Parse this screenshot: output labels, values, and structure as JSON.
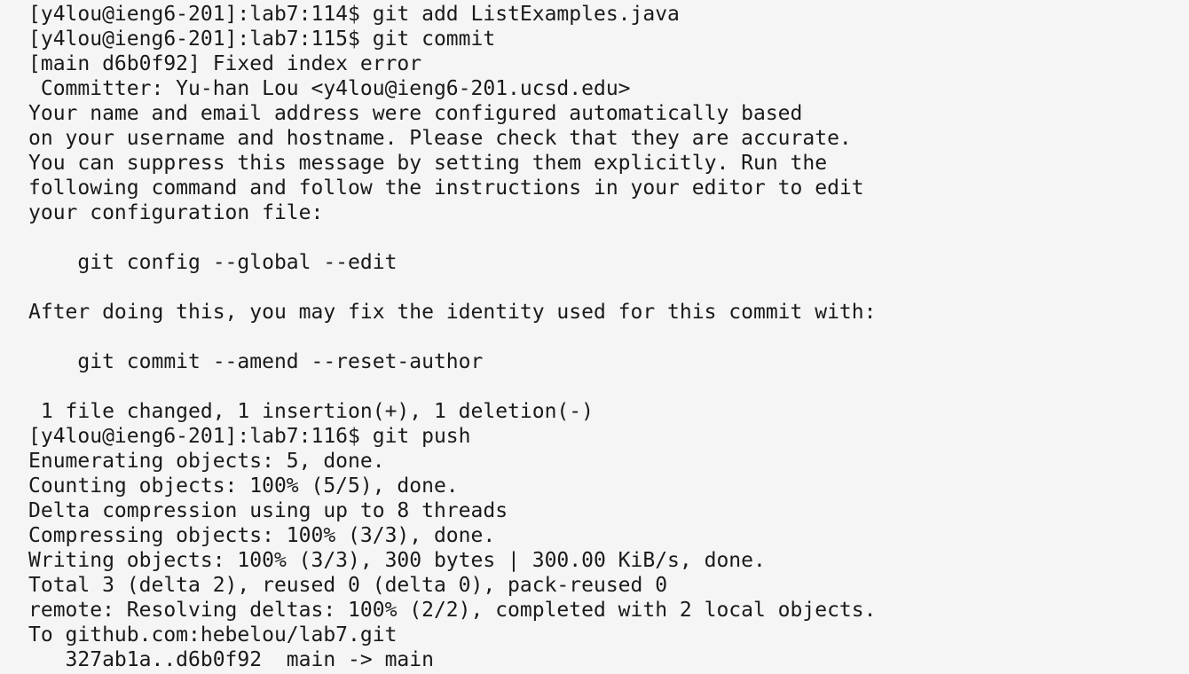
{
  "terminal": {
    "lines": [
      "[y4lou@ieng6-201]:lab7:114$ git add ListExamples.java",
      "[y4lou@ieng6-201]:lab7:115$ git commit",
      "[main d6b0f92] Fixed index error",
      " Committer: Yu-han Lou <y4lou@ieng6-201.ucsd.edu>",
      "Your name and email address were configured automatically based",
      "on your username and hostname. Please check that they are accurate.",
      "You can suppress this message by setting them explicitly. Run the",
      "following command and follow the instructions in your editor to edit",
      "your configuration file:",
      "",
      "    git config --global --edit",
      "",
      "After doing this, you may fix the identity used for this commit with:",
      "",
      "    git commit --amend --reset-author",
      "",
      " 1 file changed, 1 insertion(+), 1 deletion(-)",
      "[y4lou@ieng6-201]:lab7:116$ git push",
      "Enumerating objects: 5, done.",
      "Counting objects: 100% (5/5), done.",
      "Delta compression using up to 8 threads",
      "Compressing objects: 100% (3/3), done.",
      "Writing objects: 100% (3/3), 300 bytes | 300.00 KiB/s, done.",
      "Total 3 (delta 2), reused 0 (delta 0), pack-reused 0",
      "remote: Resolving deltas: 100% (2/2), completed with 2 local objects.",
      "To github.com:hebelou/lab7.git",
      "   327ab1a..d6b0f92  main -> main"
    ]
  }
}
